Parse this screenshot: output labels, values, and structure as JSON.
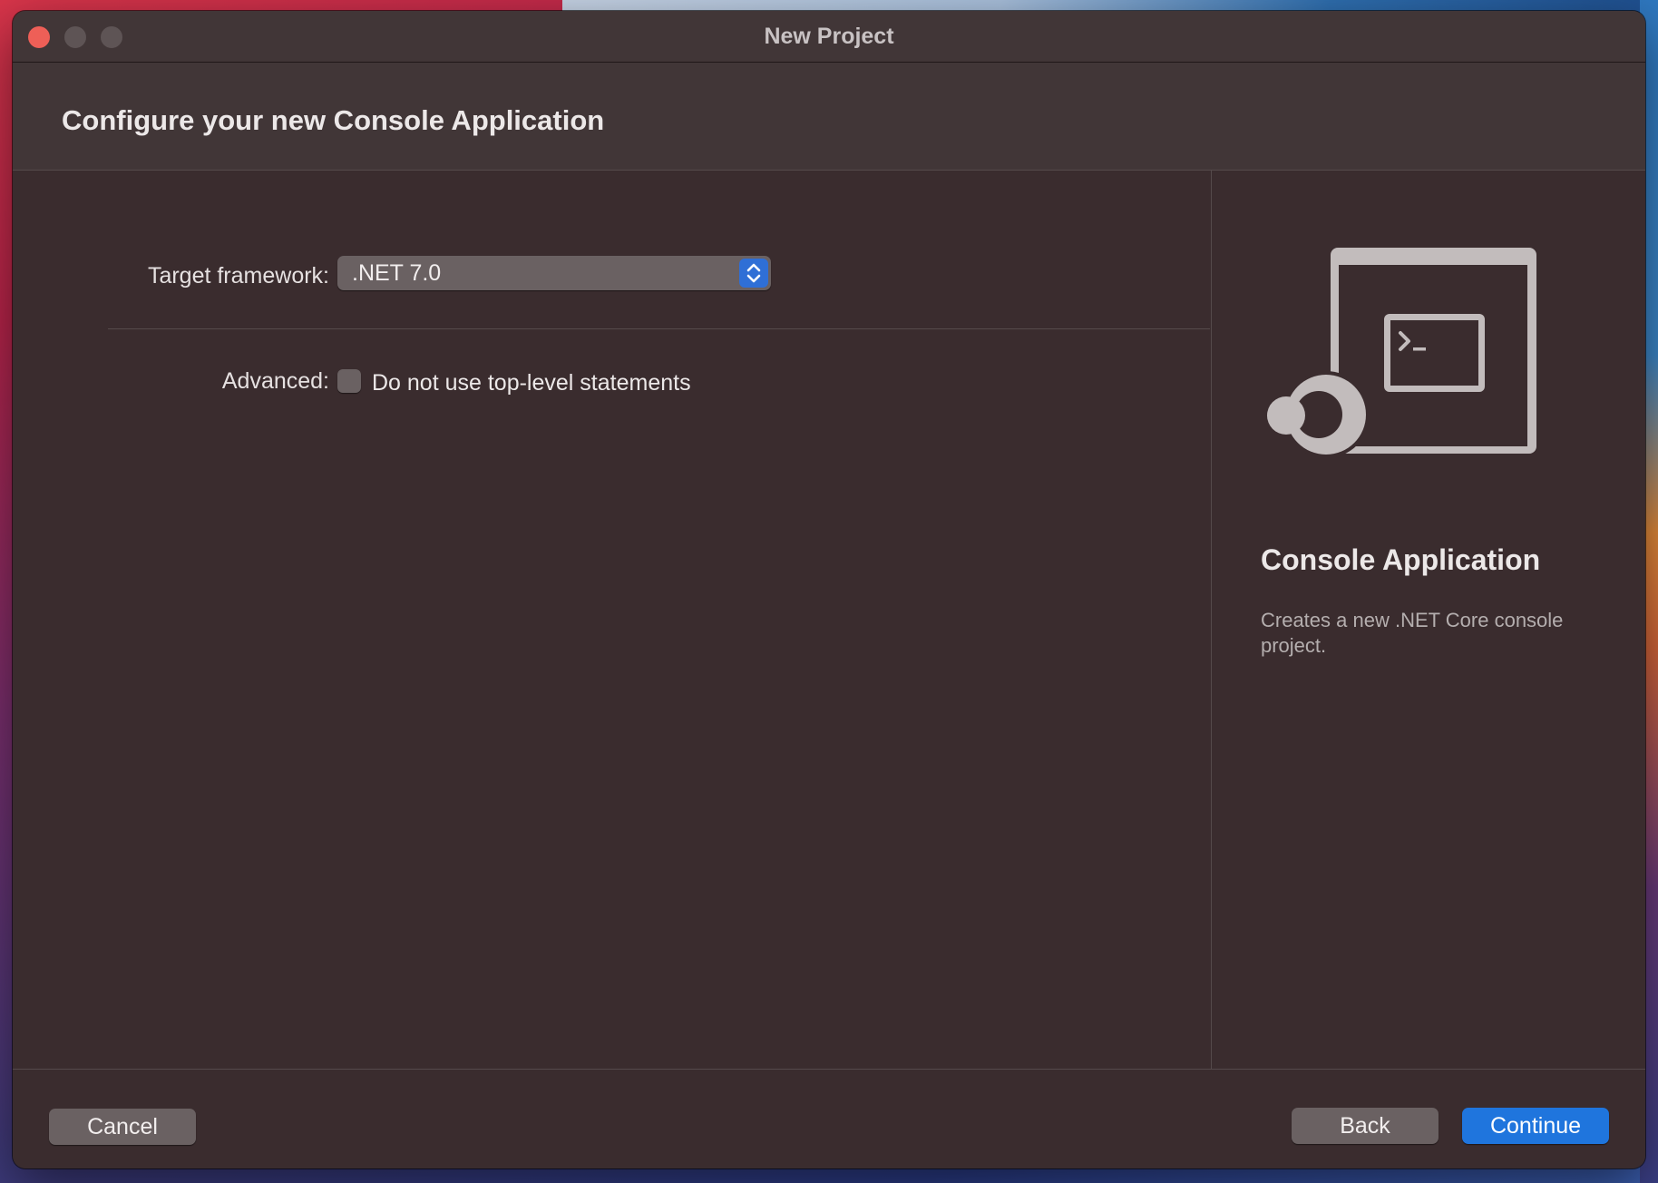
{
  "window": {
    "title": "New Project"
  },
  "header": {
    "title": "Configure your new Console Application"
  },
  "form": {
    "target_framework_label": "Target framework:",
    "target_framework_value": ".NET 7.0",
    "advanced_label": "Advanced:",
    "top_level_checkbox_label": "Do not use top-level statements",
    "top_level_checkbox_checked": false
  },
  "sidepanel": {
    "icon": "console-application-icon",
    "title": "Console Application",
    "description": "Creates a new .NET Core console project."
  },
  "footer": {
    "cancel_label": "Cancel",
    "back_label": "Back",
    "continue_label": "Continue"
  },
  "colors": {
    "accent": "#1f75dd",
    "close": "#ee5f57",
    "window_bg": "#3a2c2e"
  }
}
